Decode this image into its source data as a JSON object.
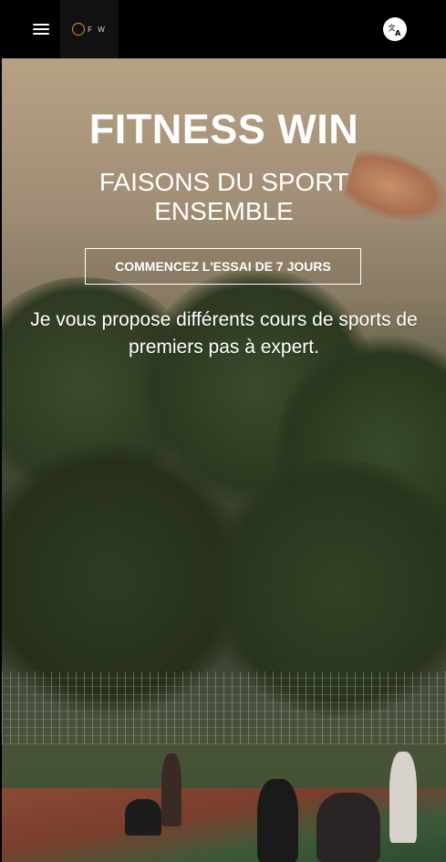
{
  "header": {
    "menu_icon": "hamburger-menu-icon",
    "logo_text": "F W",
    "language_icon": "translate-icon"
  },
  "hero": {
    "title": "FITNESS WIN",
    "subtitle": "FAISONS DU SPORT ENSEMBLE",
    "cta_label": "COMMENCEZ L'ESSAI DE 7 JOURS",
    "description": "Je vous propose différents cours de sports de premiers pas à expert."
  },
  "colors": {
    "topbar": "#000000",
    "text": "#ffffff",
    "logo_accent": "#e08a2c"
  }
}
